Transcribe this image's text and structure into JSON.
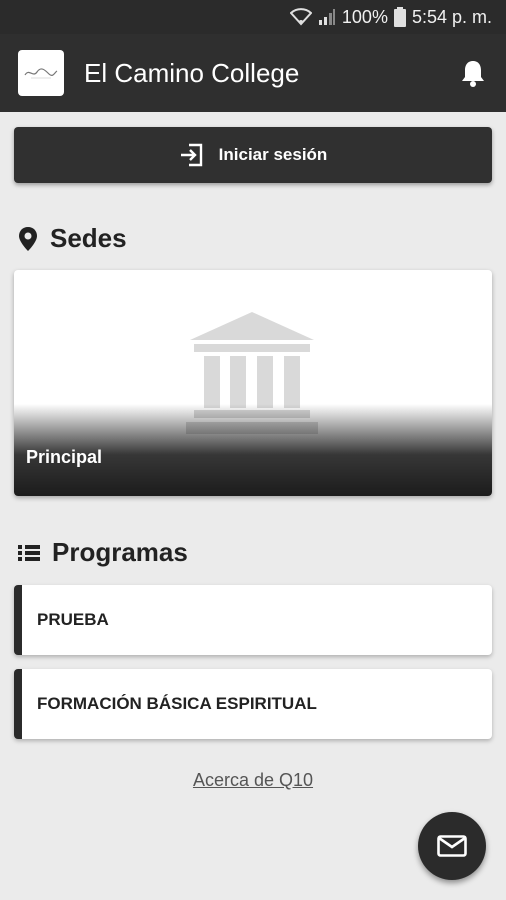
{
  "status_bar": {
    "battery": "100%",
    "time": "5:54 p. m.",
    "icons": [
      "wifi-icon",
      "signal-icon",
      "battery-icon"
    ]
  },
  "app_bar": {
    "title": "El Camino College",
    "icons": [
      "logo",
      "bell-icon"
    ]
  },
  "login": {
    "label": "Iniciar sesión",
    "icon": "login-icon"
  },
  "sedes": {
    "title": "Sedes",
    "icon": "location-pin-icon",
    "items": [
      {
        "name": "Principal",
        "image_icon": "building-icon"
      }
    ]
  },
  "programas": {
    "title": "Programas",
    "icon": "list-icon",
    "items": [
      {
        "name": "PRUEBA"
      },
      {
        "name": "FORMACIÓN BÁSICA ESPIRITUAL"
      }
    ]
  },
  "footer": {
    "about_link": "Acerca de Q10"
  },
  "fab": {
    "icon": "mail-icon"
  },
  "colors": {
    "app_bar": "#2f2f2f",
    "background": "#ebebeb",
    "accent_dark": "#2b2b2b"
  }
}
